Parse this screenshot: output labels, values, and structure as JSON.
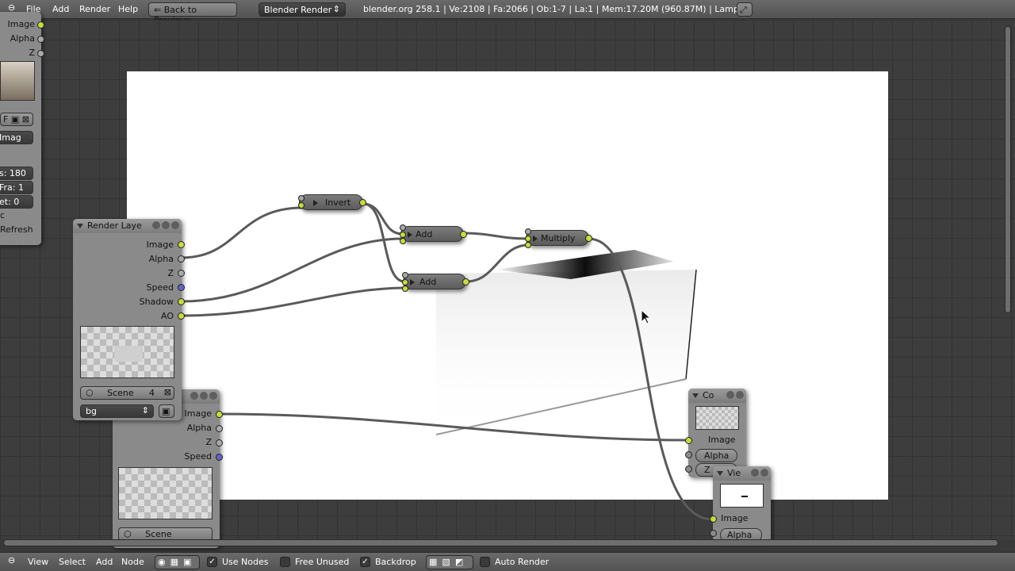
{
  "topbar": {
    "menus": [
      "File",
      "Add",
      "Render",
      "Help"
    ],
    "back_button": "Back to Previous",
    "engine": "Blender Render",
    "stats": "blender.org 258.1 | Ve:2108 | Fa:2066 | Ob:1-7 | La:1 | Mem:17.20M (960.87M) | Lamp"
  },
  "left_panel": {
    "sockets": [
      "Image",
      "Alpha",
      "Z"
    ],
    "field_imag": "Imag",
    "field_frames": "s: 180",
    "field_fra": "Fra: 1",
    "field_offset": "et: 0",
    "letter_c": "c",
    "refresh": "Refresh",
    "letter_f": "F"
  },
  "render_layer_node": {
    "title": "Render Laye",
    "outputs": [
      "Image",
      "Alpha",
      "Z",
      "Speed",
      "Shadow",
      "AO"
    ],
    "scene": "Scene",
    "scene_users": "4",
    "layer": "bg"
  },
  "render_layer_node2": {
    "outputs": [
      "Image",
      "Alpha",
      "Z",
      "Speed"
    ],
    "scene": "Scene"
  },
  "nodes": {
    "invert": "Invert",
    "add1": "Add",
    "add2": "Add",
    "multiply": "Multiply"
  },
  "composite_node": {
    "title": "Co",
    "inputs": [
      "Image",
      "Alpha",
      "Z"
    ]
  },
  "viewer_node": {
    "title": "Vie",
    "inputs": [
      "Image",
      "Alpha"
    ]
  },
  "bottombar": {
    "menus": [
      "View",
      "Select",
      "Add",
      "Node"
    ],
    "use_nodes": "Use Nodes",
    "free_unused": "Free Unused",
    "backdrop": "Backdrop",
    "auto_render": "Auto Render"
  },
  "colors": {
    "image_socket": "#c7dc3a",
    "value_socket": "#a9a9a9",
    "vector_socket": "#6464c8",
    "grid_bg": "#3d3d3d"
  }
}
